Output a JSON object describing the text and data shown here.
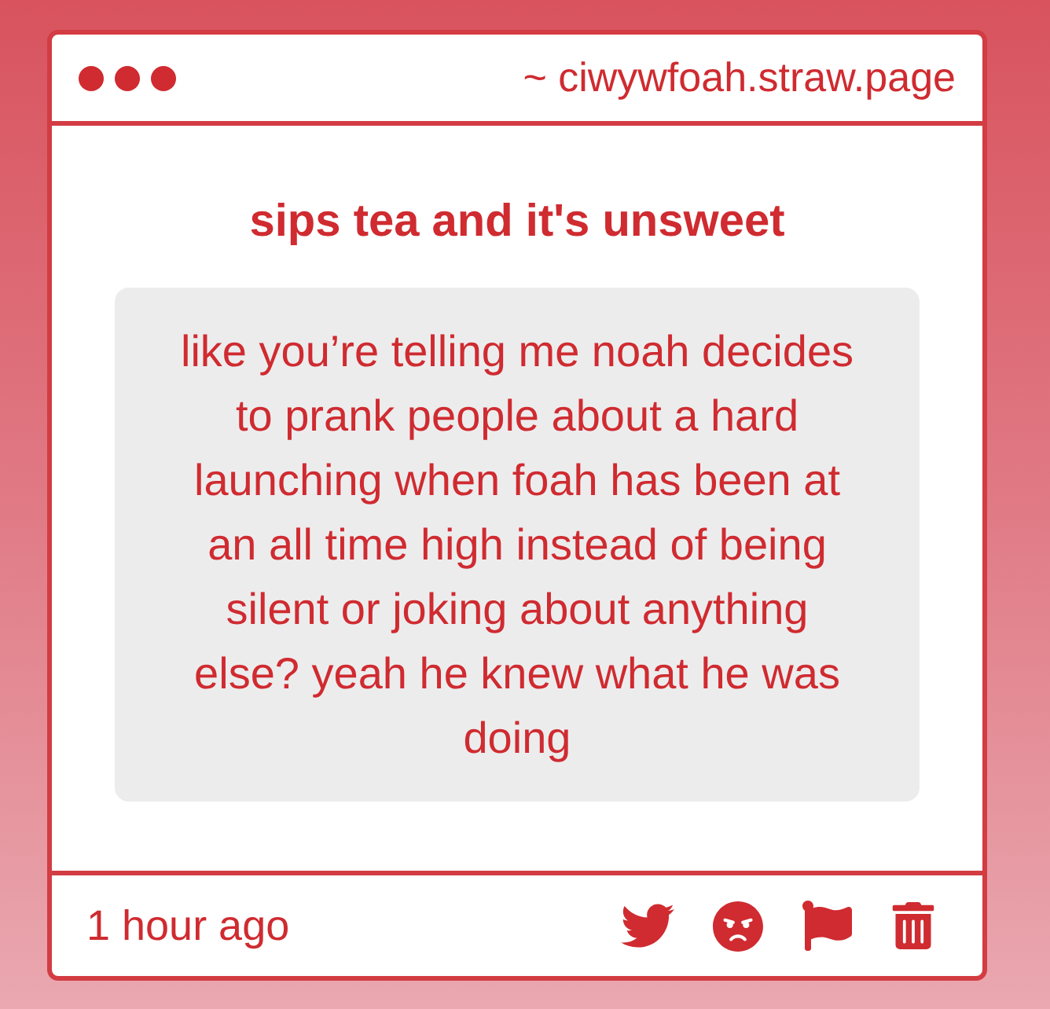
{
  "header": {
    "url": "~ ciwywfoah.straw.page"
  },
  "post": {
    "title": "sips tea and it's unsweet",
    "body": "like you’re telling me noah decides to prank people about a hard launching when foah has been at an all time high instead of being silent or joking about anything else? yeah he knew what he was doing"
  },
  "footer": {
    "time": "1 hour ago"
  }
}
